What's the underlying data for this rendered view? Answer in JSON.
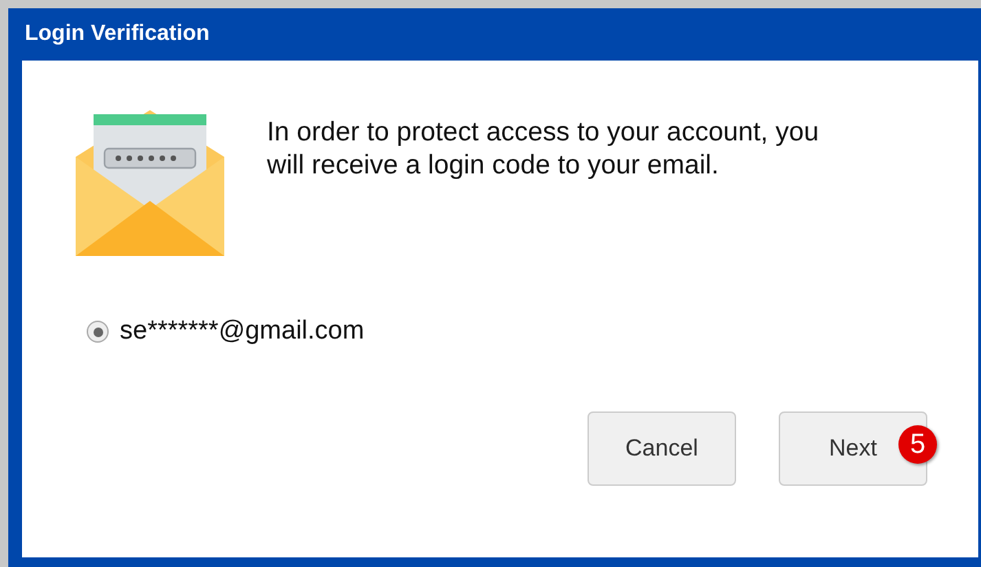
{
  "window": {
    "title": "Login Verification"
  },
  "message": "In order to protect access to your account, you will receive a login code to your email.",
  "options": [
    {
      "label": "se*******@gmail.com",
      "selected": true
    }
  ],
  "buttons": [
    {
      "label": "Cancel"
    },
    {
      "label": "Next",
      "badge": "5"
    }
  ]
}
